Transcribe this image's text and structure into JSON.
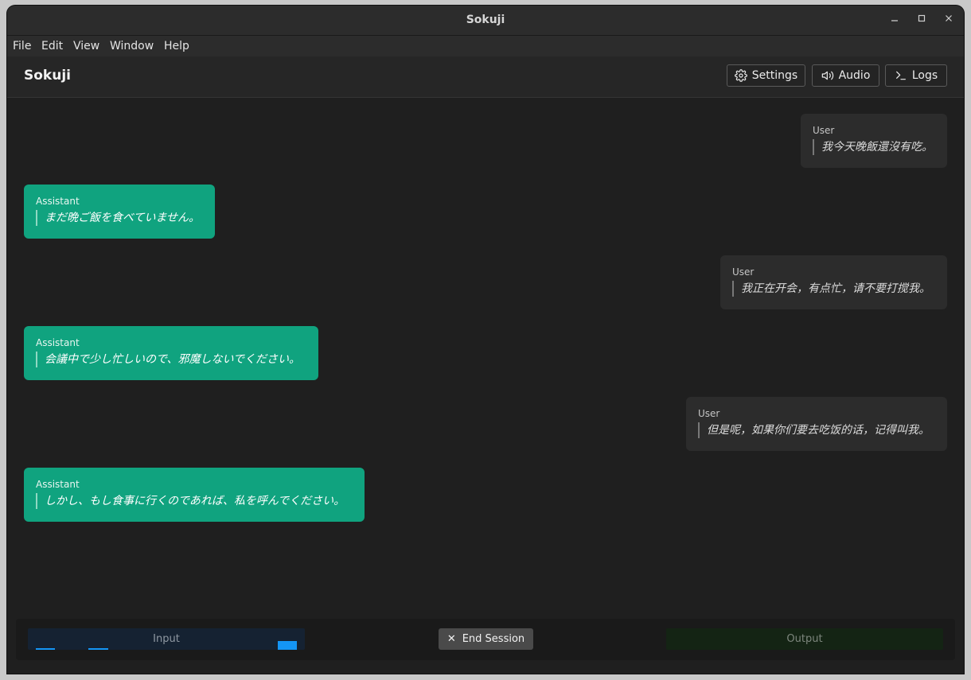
{
  "window": {
    "title": "Sokuji",
    "controls": [
      "minimize-icon",
      "maximize-icon",
      "close-icon"
    ]
  },
  "menubar": {
    "items": [
      "File",
      "Edit",
      "View",
      "Window",
      "Help"
    ]
  },
  "header": {
    "app_title": "Sokuji",
    "buttons": [
      {
        "label": "Settings",
        "icon": "gear-icon"
      },
      {
        "label": "Audio",
        "icon": "speaker-icon"
      },
      {
        "label": "Logs",
        "icon": "terminal-icon"
      }
    ]
  },
  "conversation": {
    "messages": [
      {
        "role": "User",
        "text": "我今天晚飯還沒有吃。"
      },
      {
        "role": "Assistant",
        "text": "まだ晩ご飯を食べていません。"
      },
      {
        "role": "User",
        "text": "我正在开会，有点忙，请不要打搅我。"
      },
      {
        "role": "Assistant",
        "text": "会議中で少し忙しいので、邪魔しないでください。"
      },
      {
        "role": "User",
        "text": "但是呢，如果你们要去吃饭的话，记得叫我。"
      },
      {
        "role": "Assistant",
        "text": "しかし、もし食事に行くのであれば、私を呼んでください。"
      }
    ]
  },
  "footer": {
    "input_label": "Input",
    "end_session_label": "End Session",
    "output_label": "Output"
  },
  "colors": {
    "assistant_bubble": "#10a37f",
    "user_bubble": "#2c2c2c",
    "input_meter": "#1495f5",
    "background": "#1f1f1f"
  }
}
